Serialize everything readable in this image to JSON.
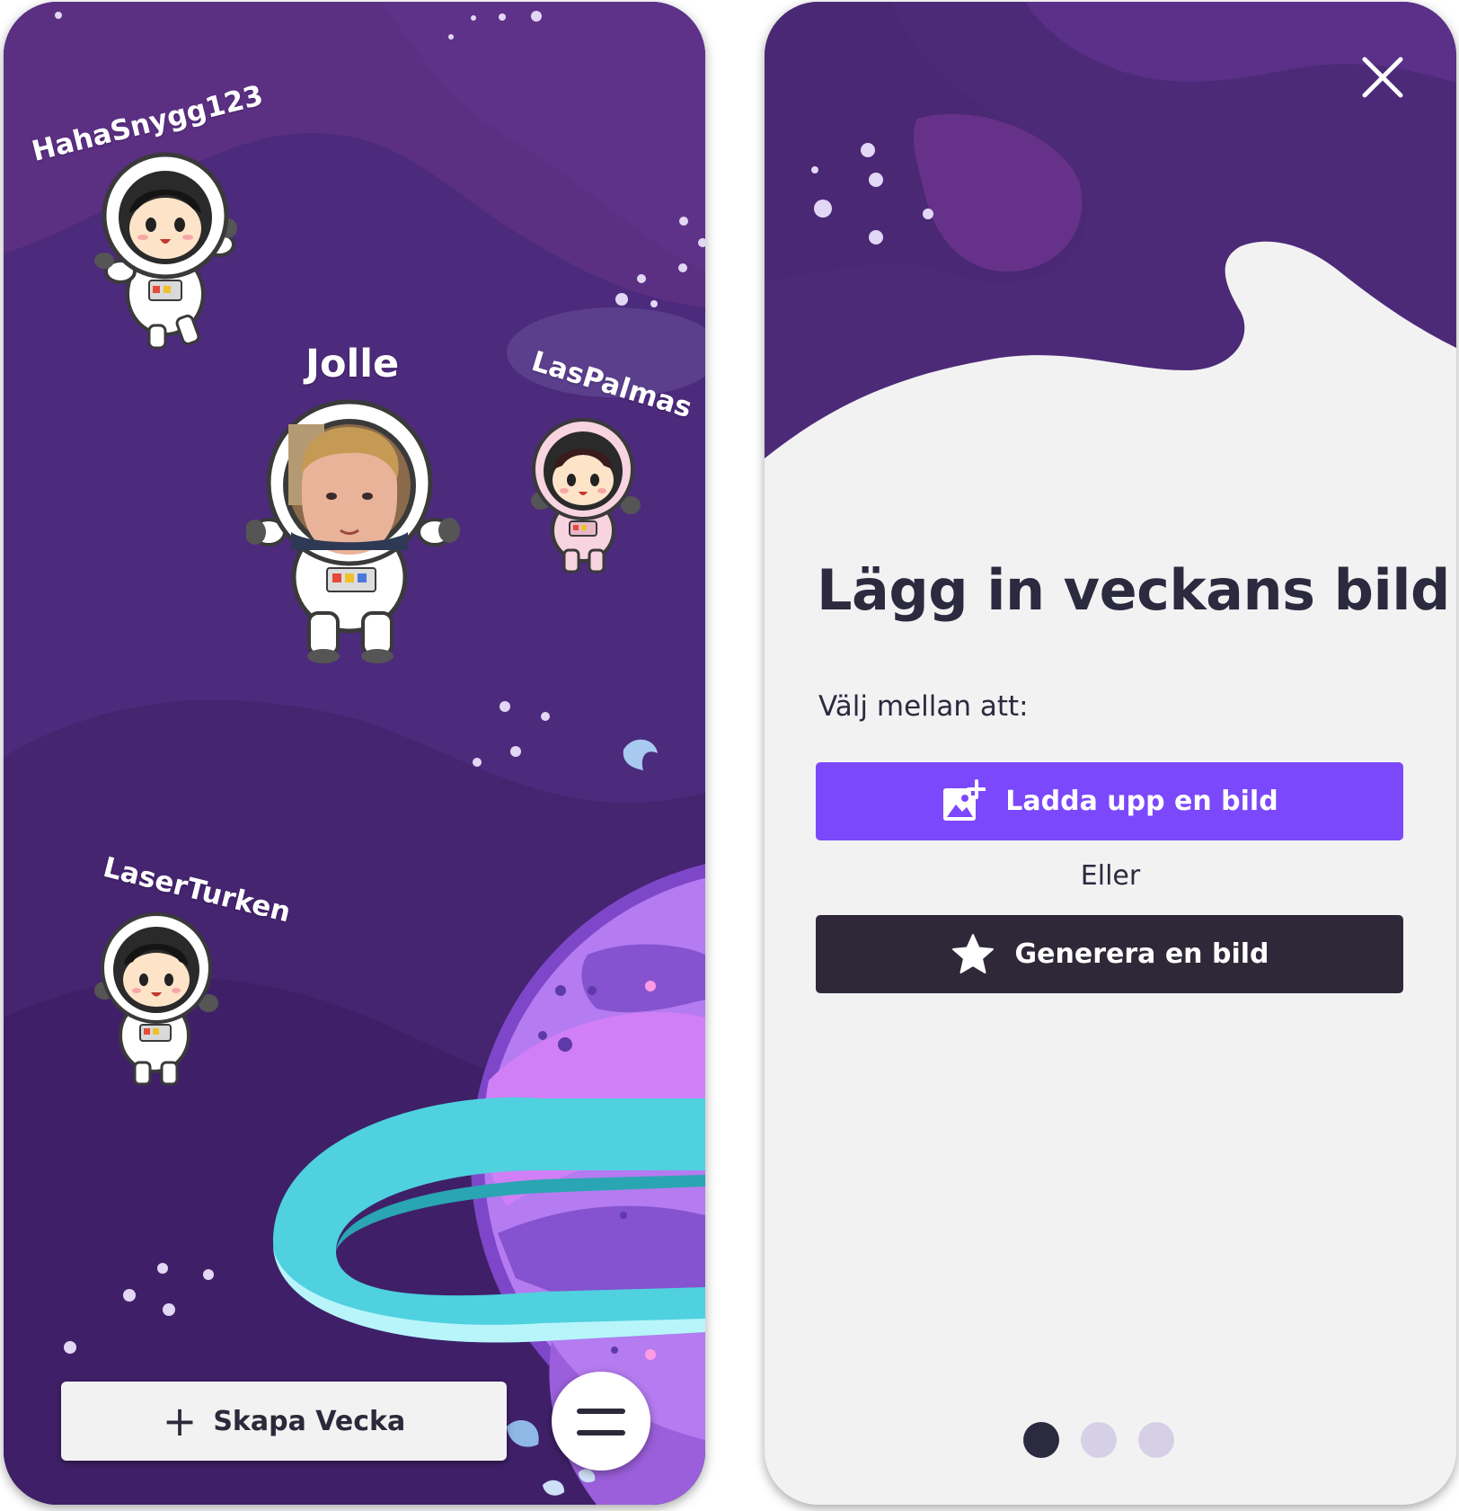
{
  "left_screen": {
    "users": [
      {
        "name": "HahaSnygg123",
        "character": "astronaut-girl"
      },
      {
        "name": "Jolle",
        "character": "astronaut-photo"
      },
      {
        "name": "LasPalmas",
        "character": "astronaut-girl-pink"
      },
      {
        "name": "LaserTurken",
        "character": "astronaut-girl"
      }
    ],
    "create_week_label": "Skapa Vecka",
    "create_week_icon": "plus-icon",
    "menu_icon": "hamburger-menu-icon"
  },
  "right_screen": {
    "close_icon": "close-icon",
    "title": "Lägg in veckans bild!",
    "subtitle": "Välj mellan att:",
    "upload_button": {
      "label": "Ladda upp en bild",
      "icon": "add-image-icon"
    },
    "or_text": "Eller",
    "generate_button": {
      "label": "Generera en bild",
      "icon": "star-icon"
    },
    "pagination": {
      "pages": 3,
      "active": 1
    }
  },
  "colors": {
    "space_purple": "#4a2a7a",
    "accent_purple": "#7c48fb",
    "dark_button": "#2e2838",
    "text_dark": "#2b2a3f",
    "page_dot_active": "#2b2a3f",
    "page_dot_inactive": "#d6d0e6"
  }
}
